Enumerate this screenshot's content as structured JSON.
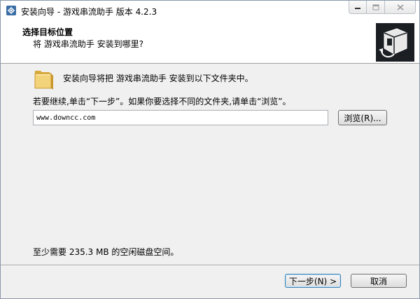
{
  "window": {
    "title": "安装向导 - 游戏串流助手 版本 4.2.3"
  },
  "header": {
    "title": "选择目标位置",
    "subtitle": "将 游戏串流助手 安装到哪里?"
  },
  "main": {
    "install_text": "安装向导将把 游戏串流助手 安装到以下文件夹中。",
    "continue_text": "若要继续,单击“下一步”。如果你要选择不同的文件夹,请单击“浏览”。",
    "path_value": "www.downcc.com",
    "browse_label": "浏览(R)...",
    "space_text": "至少需要 235.3 MB 的空闲磁盘空间。"
  },
  "footer": {
    "next_label": "下一步(N) >",
    "cancel_label": "取消"
  },
  "icons": {
    "app": "installer-app-icon",
    "folder": "folder-icon",
    "logo": "setup-computer-box-icon",
    "minimize": "minimize-icon",
    "maximize": "maximize-icon",
    "close": "close-icon"
  }
}
